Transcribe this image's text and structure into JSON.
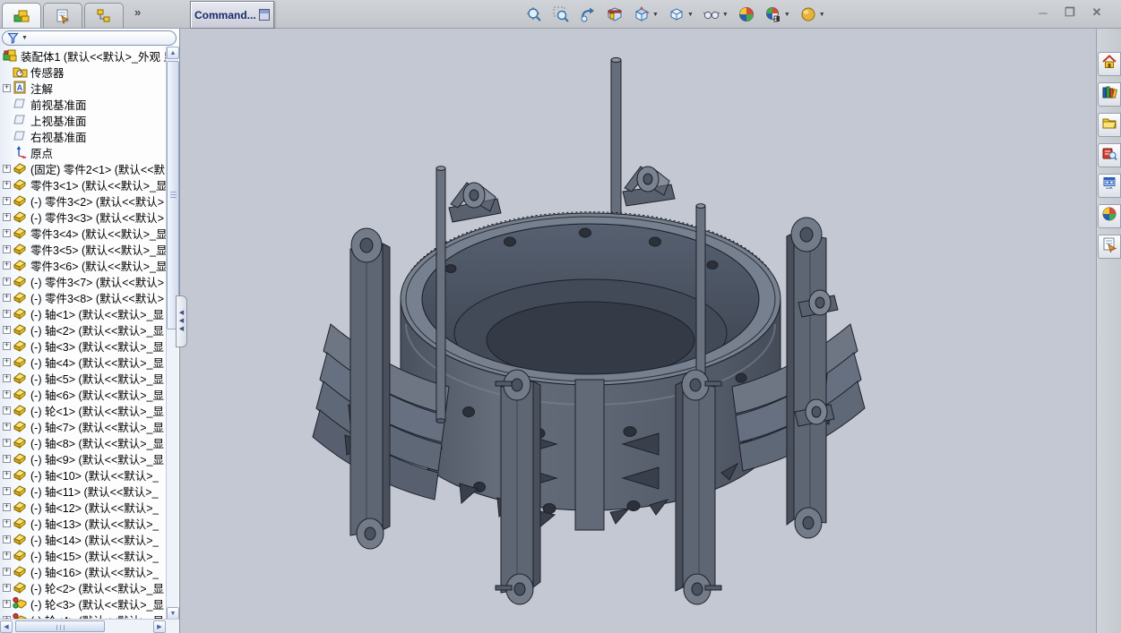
{
  "window": {
    "controls": [
      {
        "name": "minimize",
        "glyph": "─"
      },
      {
        "name": "restore",
        "glyph": "❐"
      },
      {
        "name": "close",
        "glyph": "✕"
      }
    ]
  },
  "command_box": {
    "label": "Command..."
  },
  "feature_manager": {
    "tabs": [
      {
        "name": "featuremanager-design-tree",
        "active": true
      },
      {
        "name": "propertymanager",
        "active": false
      },
      {
        "name": "configurationmanager",
        "active": false
      }
    ],
    "overflow_chevron": "»",
    "filter": {
      "icon": "filter-funnel-icon"
    },
    "tree_items": [
      {
        "icon": "assembly",
        "label": "装配体1  (默认<<默认>_外观 显",
        "expand": false,
        "indent": 0
      },
      {
        "icon": "sensors",
        "label": "传感器",
        "expand": false,
        "indent": 1
      },
      {
        "icon": "annotations",
        "label": "注解",
        "expand": true,
        "indent": 1
      },
      {
        "icon": "plane",
        "label": "前视基准面",
        "expand": false,
        "indent": 1
      },
      {
        "icon": "plane",
        "label": "上视基准面",
        "expand": false,
        "indent": 1
      },
      {
        "icon": "plane",
        "label": "右视基准面",
        "expand": false,
        "indent": 1
      },
      {
        "icon": "origin",
        "label": "原点",
        "expand": false,
        "indent": 1
      },
      {
        "icon": "part",
        "label": "(固定) 零件2<1> (默认<<默",
        "expand": true,
        "indent": 1
      },
      {
        "icon": "part",
        "label": "零件3<1> (默认<<默认>_显",
        "expand": true,
        "indent": 1
      },
      {
        "icon": "part",
        "label": "(-) 零件3<2> (默认<<默认>",
        "expand": true,
        "indent": 1
      },
      {
        "icon": "part",
        "label": "(-) 零件3<3> (默认<<默认>",
        "expand": true,
        "indent": 1
      },
      {
        "icon": "part",
        "label": "零件3<4> (默认<<默认>_显",
        "expand": true,
        "indent": 1
      },
      {
        "icon": "part",
        "label": "零件3<5> (默认<<默认>_显",
        "expand": true,
        "indent": 1
      },
      {
        "icon": "part",
        "label": "零件3<6> (默认<<默认>_显",
        "expand": true,
        "indent": 1
      },
      {
        "icon": "part",
        "label": "(-) 零件3<7> (默认<<默认>",
        "expand": true,
        "indent": 1
      },
      {
        "icon": "part",
        "label": "(-) 零件3<8> (默认<<默认>",
        "expand": true,
        "indent": 1
      },
      {
        "icon": "part",
        "label": "(-) 轴<1> (默认<<默认>_显",
        "expand": true,
        "indent": 1
      },
      {
        "icon": "part",
        "label": "(-) 轴<2> (默认<<默认>_显",
        "expand": true,
        "indent": 1
      },
      {
        "icon": "part",
        "label": "(-) 轴<3> (默认<<默认>_显",
        "expand": true,
        "indent": 1
      },
      {
        "icon": "part",
        "label": "(-) 轴<4> (默认<<默认>_显",
        "expand": true,
        "indent": 1
      },
      {
        "icon": "part",
        "label": "(-) 轴<5> (默认<<默认>_显",
        "expand": true,
        "indent": 1
      },
      {
        "icon": "part",
        "label": "(-) 轴<6> (默认<<默认>_显",
        "expand": true,
        "indent": 1
      },
      {
        "icon": "part",
        "label": "(-) 轮<1> (默认<<默认>_显",
        "expand": true,
        "indent": 1
      },
      {
        "icon": "part",
        "label": "(-) 轴<7> (默认<<默认>_显",
        "expand": true,
        "indent": 1
      },
      {
        "icon": "part",
        "label": "(-) 轴<8> (默认<<默认>_显",
        "expand": true,
        "indent": 1
      },
      {
        "icon": "part",
        "label": "(-) 轴<9> (默认<<默认>_显",
        "expand": true,
        "indent": 1
      },
      {
        "icon": "part",
        "label": "(-) 轴<10> (默认<<默认>_",
        "expand": true,
        "indent": 1
      },
      {
        "icon": "part",
        "label": "(-) 轴<11> (默认<<默认>_",
        "expand": true,
        "indent": 1
      },
      {
        "icon": "part",
        "label": "(-) 轴<12> (默认<<默认>_",
        "expand": true,
        "indent": 1
      },
      {
        "icon": "part",
        "label": "(-) 轴<13> (默认<<默认>_",
        "expand": true,
        "indent": 1
      },
      {
        "icon": "part",
        "label": "(-) 轴<14> (默认<<默认>_",
        "expand": true,
        "indent": 1
      },
      {
        "icon": "part",
        "label": "(-) 轴<15> (默认<<默认>_",
        "expand": true,
        "indent": 1
      },
      {
        "icon": "part",
        "label": "(-) 轴<16> (默认<<默认>_",
        "expand": true,
        "indent": 1
      },
      {
        "icon": "part",
        "label": "(-) 轮<2> (默认<<默认>_显",
        "expand": true,
        "indent": 1
      },
      {
        "icon": "part-lights",
        "label": "(-) 轮<3> (默认<<默认>_显",
        "expand": true,
        "indent": 1
      },
      {
        "icon": "part-lights",
        "label": "(-) 轮<4> (默认<<默认>_显",
        "expand": true,
        "indent": 1
      }
    ]
  },
  "view_toolbar": {
    "buttons": [
      {
        "id": "zoom-to-fit",
        "dropdown": false
      },
      {
        "id": "zoom-to-area",
        "dropdown": false
      },
      {
        "id": "previous-view",
        "dropdown": false
      },
      {
        "id": "section-view",
        "dropdown": false
      },
      {
        "id": "view-orientation",
        "dropdown": true
      },
      {
        "id": "display-style",
        "dropdown": true
      },
      {
        "id": "hide-show-items",
        "dropdown": true
      },
      {
        "id": "edit-appearance",
        "dropdown": false
      },
      {
        "id": "apply-scene",
        "dropdown": true
      },
      {
        "id": "view-settings",
        "dropdown": true
      }
    ]
  },
  "task_pane": {
    "tabs": [
      {
        "id": "solidworks-resources",
        "icon": "home"
      },
      {
        "id": "design-library",
        "icon": "library"
      },
      {
        "id": "file-explorer",
        "icon": "folder"
      },
      {
        "id": "search",
        "icon": "search-red"
      },
      {
        "id": "view-palette",
        "icon": "palette"
      },
      {
        "id": "appearances-scenes",
        "icon": "ball"
      },
      {
        "id": "custom-properties",
        "icon": "props"
      }
    ]
  },
  "viewport": {
    "content": "3d-assembly-model",
    "colors": {
      "background": "#c3c8d2",
      "model_light": "#7c8492",
      "model_mid": "#5d6573",
      "model_dark": "#454c59",
      "model_darker": "#343a46",
      "edge": "#1d212a"
    }
  }
}
